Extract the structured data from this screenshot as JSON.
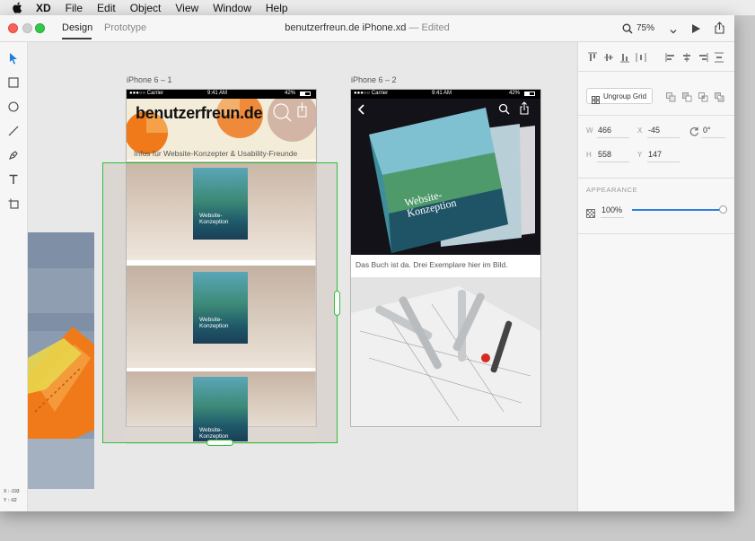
{
  "menubar": {
    "app": "XD",
    "items": [
      "File",
      "Edit",
      "Object",
      "View",
      "Window",
      "Help"
    ]
  },
  "window": {
    "tabs": {
      "design": "Design",
      "prototype": "Prototype"
    },
    "title": "benutzerfreun.de iPhone.xd",
    "edited": "— Edited",
    "zoom": "75%"
  },
  "canvas": {
    "artboard1": {
      "label": "iPhone 6 – 1",
      "status_carrier": "●●●○○ Carrier",
      "status_time": "9:41 AM",
      "status_battery": "42%",
      "logo_text": "benutzerfreun.de",
      "tagline": "Infos für Website-Konzepter & Usability-Freunde",
      "book_title": "Website-Konzeption"
    },
    "artboard2": {
      "label": "iPhone 6 – 2",
      "status_carrier": "●●●○○ Carrier",
      "status_time": "9:41 AM",
      "status_battery": "42%",
      "book_title": "Website-Konzeption",
      "caption": "Das Buch ist da. Drei Exemplare hier im Bild."
    },
    "cursor": {
      "x": "X : -193",
      "y": "Y : -62"
    }
  },
  "panel": {
    "ungroup_label": "Ungroup Grid",
    "w_label": "W",
    "w_value": "466",
    "x_label": "X",
    "x_value": "-45",
    "rotation_value": "0°",
    "h_label": "H",
    "h_value": "558",
    "y_label": "Y",
    "y_value": "147",
    "appearance_label": "APPEARANCE",
    "opacity_value": "100%",
    "opacity_fraction": 1.0
  },
  "colors": {
    "accent": "#2f7fe0",
    "selection": "#2fbf3a",
    "orange": "#f07a1a"
  }
}
